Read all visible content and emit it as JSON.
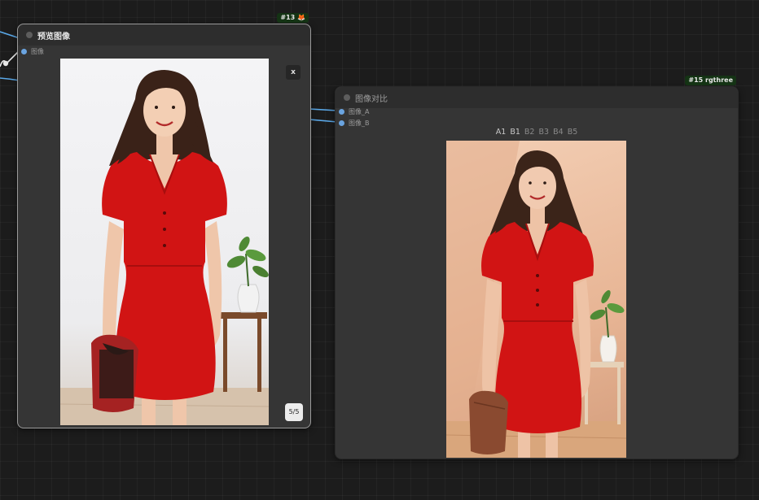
{
  "nodes": {
    "preview": {
      "badge": "#13 🦊",
      "title": "预览图像",
      "input_label": "图像",
      "close_label": "x",
      "counter": "5/5"
    },
    "compare": {
      "badge": "#15 rgthree",
      "title": "图像对比",
      "inputs": [
        "图像_A",
        "图像_B"
      ],
      "tabs": [
        "A1",
        "B1",
        "B2",
        "B3",
        "B4",
        "B5"
      ],
      "active_tabs": [
        "A1",
        "B1"
      ]
    }
  },
  "colors": {
    "canvas": "#1c1c1c",
    "node_body": "#353535",
    "node_header": "#2d2d2d",
    "socket": "#6aa4e0",
    "badge_bg": "#143314",
    "dress_red": "#d11414"
  },
  "icons": {
    "badge_icon": "fox-icon"
  }
}
